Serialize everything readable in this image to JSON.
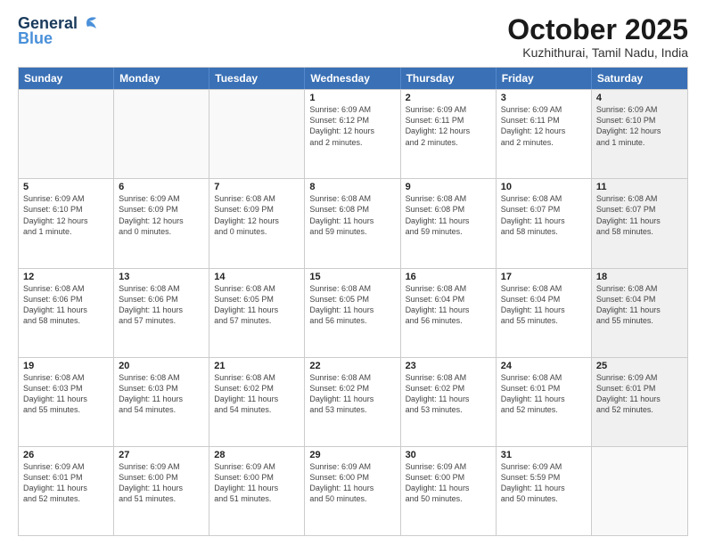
{
  "logo": {
    "general": "General",
    "blue": "Blue"
  },
  "title": "October 2025",
  "location": "Kuzhithurai, Tamil Nadu, India",
  "weekdays": [
    "Sunday",
    "Monday",
    "Tuesday",
    "Wednesday",
    "Thursday",
    "Friday",
    "Saturday"
  ],
  "rows": [
    [
      {
        "day": "",
        "text": "",
        "empty": true
      },
      {
        "day": "",
        "text": "",
        "empty": true
      },
      {
        "day": "",
        "text": "",
        "empty": true
      },
      {
        "day": "1",
        "text": "Sunrise: 6:09 AM\nSunset: 6:12 PM\nDaylight: 12 hours\nand 2 minutes."
      },
      {
        "day": "2",
        "text": "Sunrise: 6:09 AM\nSunset: 6:11 PM\nDaylight: 12 hours\nand 2 minutes."
      },
      {
        "day": "3",
        "text": "Sunrise: 6:09 AM\nSunset: 6:11 PM\nDaylight: 12 hours\nand 2 minutes."
      },
      {
        "day": "4",
        "text": "Sunrise: 6:09 AM\nSunset: 6:10 PM\nDaylight: 12 hours\nand 1 minute.",
        "shaded": true
      }
    ],
    [
      {
        "day": "5",
        "text": "Sunrise: 6:09 AM\nSunset: 6:10 PM\nDaylight: 12 hours\nand 1 minute."
      },
      {
        "day": "6",
        "text": "Sunrise: 6:09 AM\nSunset: 6:09 PM\nDaylight: 12 hours\nand 0 minutes."
      },
      {
        "day": "7",
        "text": "Sunrise: 6:08 AM\nSunset: 6:09 PM\nDaylight: 12 hours\nand 0 minutes."
      },
      {
        "day": "8",
        "text": "Sunrise: 6:08 AM\nSunset: 6:08 PM\nDaylight: 11 hours\nand 59 minutes."
      },
      {
        "day": "9",
        "text": "Sunrise: 6:08 AM\nSunset: 6:08 PM\nDaylight: 11 hours\nand 59 minutes."
      },
      {
        "day": "10",
        "text": "Sunrise: 6:08 AM\nSunset: 6:07 PM\nDaylight: 11 hours\nand 58 minutes."
      },
      {
        "day": "11",
        "text": "Sunrise: 6:08 AM\nSunset: 6:07 PM\nDaylight: 11 hours\nand 58 minutes.",
        "shaded": true
      }
    ],
    [
      {
        "day": "12",
        "text": "Sunrise: 6:08 AM\nSunset: 6:06 PM\nDaylight: 11 hours\nand 58 minutes."
      },
      {
        "day": "13",
        "text": "Sunrise: 6:08 AM\nSunset: 6:06 PM\nDaylight: 11 hours\nand 57 minutes."
      },
      {
        "day": "14",
        "text": "Sunrise: 6:08 AM\nSunset: 6:05 PM\nDaylight: 11 hours\nand 57 minutes."
      },
      {
        "day": "15",
        "text": "Sunrise: 6:08 AM\nSunset: 6:05 PM\nDaylight: 11 hours\nand 56 minutes."
      },
      {
        "day": "16",
        "text": "Sunrise: 6:08 AM\nSunset: 6:04 PM\nDaylight: 11 hours\nand 56 minutes."
      },
      {
        "day": "17",
        "text": "Sunrise: 6:08 AM\nSunset: 6:04 PM\nDaylight: 11 hours\nand 55 minutes."
      },
      {
        "day": "18",
        "text": "Sunrise: 6:08 AM\nSunset: 6:04 PM\nDaylight: 11 hours\nand 55 minutes.",
        "shaded": true
      }
    ],
    [
      {
        "day": "19",
        "text": "Sunrise: 6:08 AM\nSunset: 6:03 PM\nDaylight: 11 hours\nand 55 minutes."
      },
      {
        "day": "20",
        "text": "Sunrise: 6:08 AM\nSunset: 6:03 PM\nDaylight: 11 hours\nand 54 minutes."
      },
      {
        "day": "21",
        "text": "Sunrise: 6:08 AM\nSunset: 6:02 PM\nDaylight: 11 hours\nand 54 minutes."
      },
      {
        "day": "22",
        "text": "Sunrise: 6:08 AM\nSunset: 6:02 PM\nDaylight: 11 hours\nand 53 minutes."
      },
      {
        "day": "23",
        "text": "Sunrise: 6:08 AM\nSunset: 6:02 PM\nDaylight: 11 hours\nand 53 minutes."
      },
      {
        "day": "24",
        "text": "Sunrise: 6:08 AM\nSunset: 6:01 PM\nDaylight: 11 hours\nand 52 minutes."
      },
      {
        "day": "25",
        "text": "Sunrise: 6:09 AM\nSunset: 6:01 PM\nDaylight: 11 hours\nand 52 minutes.",
        "shaded": true
      }
    ],
    [
      {
        "day": "26",
        "text": "Sunrise: 6:09 AM\nSunset: 6:01 PM\nDaylight: 11 hours\nand 52 minutes."
      },
      {
        "day": "27",
        "text": "Sunrise: 6:09 AM\nSunset: 6:00 PM\nDaylight: 11 hours\nand 51 minutes."
      },
      {
        "day": "28",
        "text": "Sunrise: 6:09 AM\nSunset: 6:00 PM\nDaylight: 11 hours\nand 51 minutes."
      },
      {
        "day": "29",
        "text": "Sunrise: 6:09 AM\nSunset: 6:00 PM\nDaylight: 11 hours\nand 50 minutes."
      },
      {
        "day": "30",
        "text": "Sunrise: 6:09 AM\nSunset: 6:00 PM\nDaylight: 11 hours\nand 50 minutes."
      },
      {
        "day": "31",
        "text": "Sunrise: 6:09 AM\nSunset: 5:59 PM\nDaylight: 11 hours\nand 50 minutes."
      },
      {
        "day": "",
        "text": "",
        "empty": true
      }
    ]
  ]
}
